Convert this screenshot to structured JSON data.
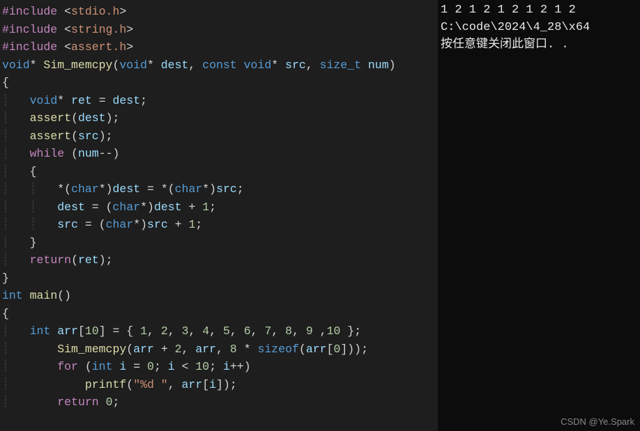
{
  "code": {
    "includes": [
      "stdio.h",
      "string.h",
      "assert.h"
    ],
    "fn1": {
      "ret_type": "void",
      "star": "*",
      "name": "Sim_memcpy",
      "p1_type": "void",
      "p1_name": "dest",
      "p2_mod": "const",
      "p2_type": "void",
      "p2_name": "src",
      "p3_type": "size_t",
      "p3_name": "num"
    },
    "body": {
      "ret_decl_type": "void",
      "ret_var": "ret",
      "ret_init": "dest",
      "assert1": "assert",
      "assert1_arg": "dest",
      "assert2": "assert",
      "assert2_arg": "src",
      "while_kw": "while",
      "while_cond": "num--",
      "cast_type": "char",
      "line_a_dest": "dest",
      "line_a_src": "src",
      "line_b_lhs": "dest",
      "line_b_rhs": "dest",
      "line_b_plus1": "1",
      "line_c_lhs": "src",
      "line_c_rhs": "src",
      "line_c_plus1": "1",
      "return_kw": "return",
      "return_val": "ret"
    },
    "main": {
      "ret_type": "int",
      "name": "main",
      "arr_type": "int",
      "arr_name": "arr",
      "arr_size": "10",
      "arr_init": [
        "1",
        "2",
        "3",
        "4",
        "5",
        "6",
        "7",
        "8",
        "9",
        "10"
      ],
      "call": "Sim_memcpy",
      "call_a1": "arr",
      "call_a1_off": "2",
      "call_a2": "arr",
      "call_a3_mult": "8",
      "sizeof_kw": "sizeof",
      "sizeof_arg": "arr",
      "sizeof_idx": "0",
      "for_kw": "for",
      "for_type": "int",
      "for_var": "i",
      "for_init": "0",
      "for_cmp": "10",
      "printf": "printf",
      "printf_fmt": "\"%d \"",
      "printf_arg": "arr",
      "printf_idx": "i",
      "return_kw": "return",
      "return_val": "0"
    }
  },
  "terminal": {
    "line1": "1 2 1 2 1 2 1 2 1 2",
    "line2": "C:\\code\\2024\\4_28\\x64",
    "line3": "按任意键关闭此窗口. ."
  },
  "watermark": "CSDN @Ye.Spark"
}
